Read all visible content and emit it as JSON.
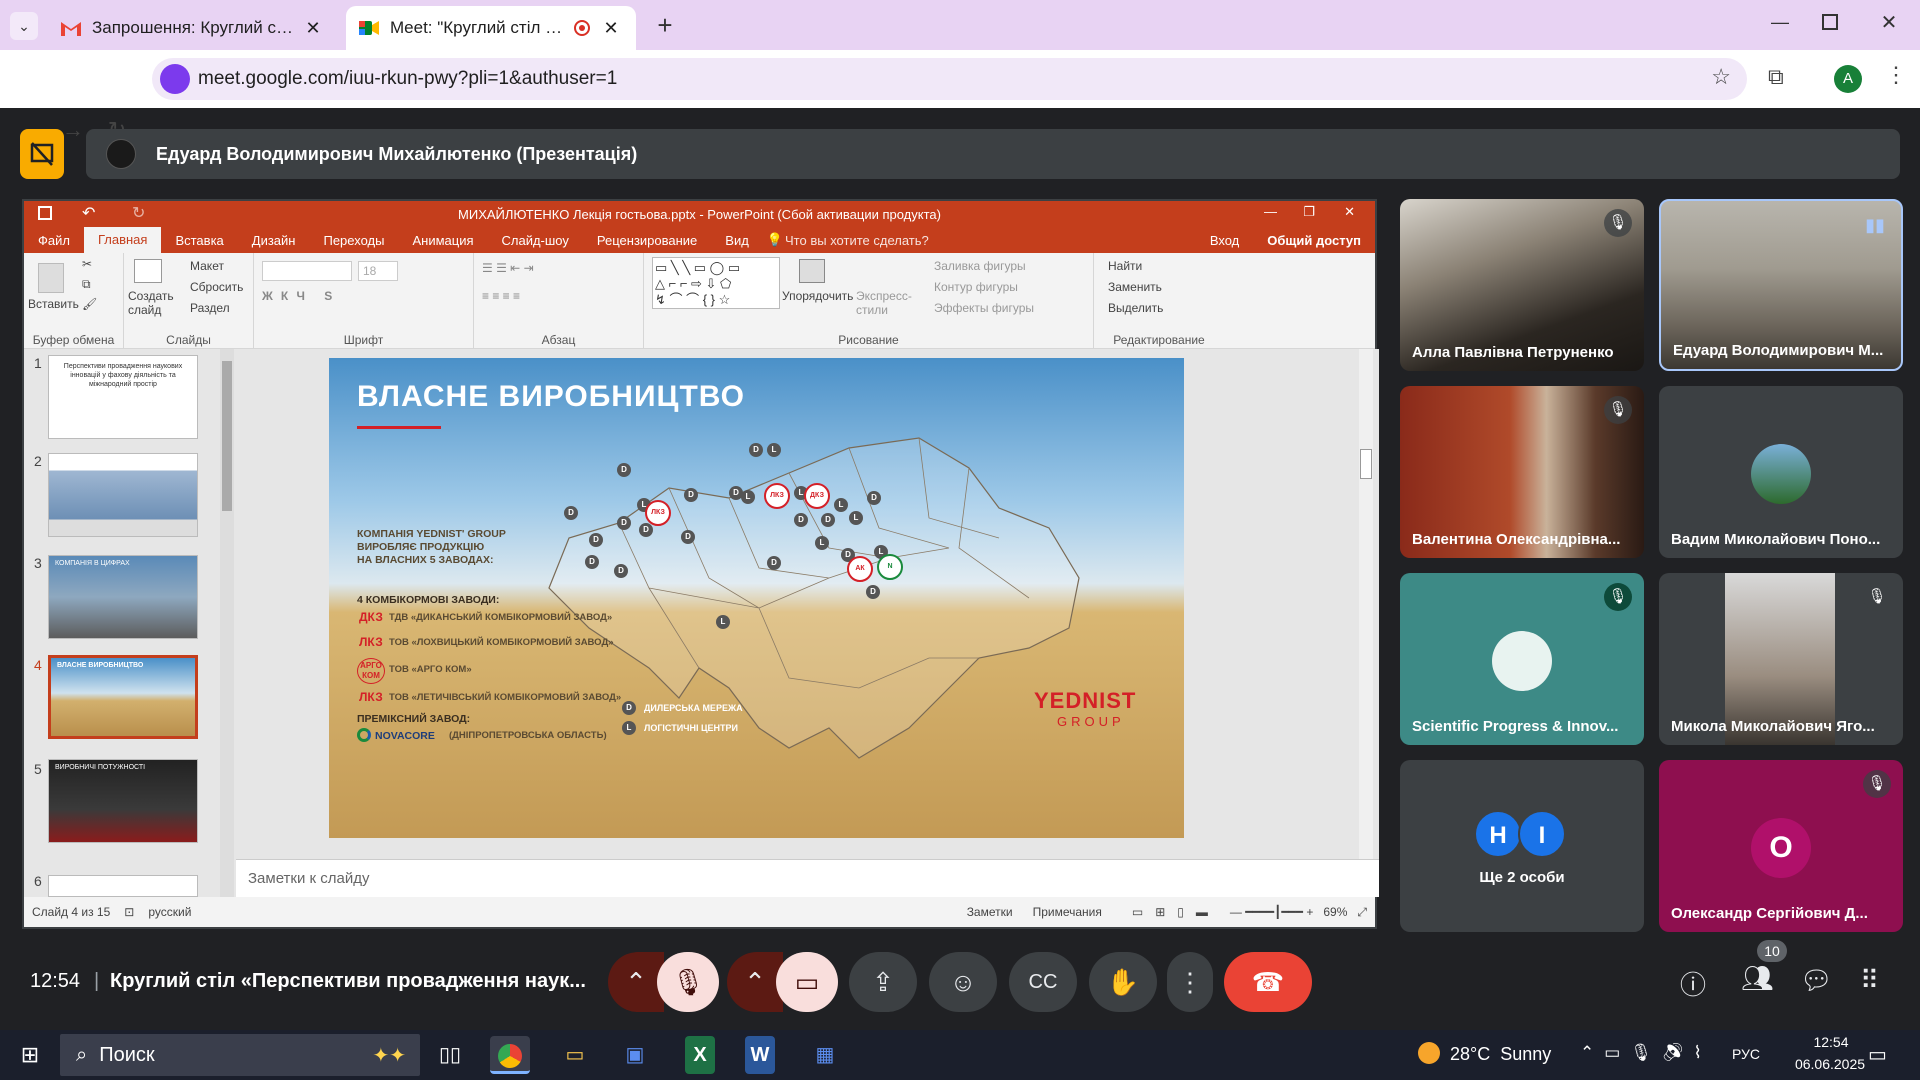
{
  "browser": {
    "tabs": [
      {
        "title": "Запрошення: Круглий стіл «Пе",
        "icon": "gmail-icon"
      },
      {
        "title": "Meet: \"Круглий стіл «Персп",
        "icon": "meet-icon"
      }
    ],
    "new_tab": "+",
    "url": "meet.google.com/iuu-rkun-pwy?pli=1&authuser=1",
    "profile_initial": "A"
  },
  "meet": {
    "presenter_label": "Едуард Володимирович Михайлютенко (Презентація)",
    "time": "12:54",
    "meeting_title": "Круглий стіл «Перспективи провадження наук...",
    "participant_count": "10",
    "participants": [
      {
        "name": "Алла Павлівна Петруненко",
        "muted": true
      },
      {
        "name": "Едуард Володимирович М...",
        "muted": false,
        "speaking": true
      },
      {
        "name": "Валентина Олександрівна...",
        "muted": true
      },
      {
        "name": "Вадим Миколайович Поно...",
        "muted": false
      },
      {
        "name": "Scientific Progress & Innov...",
        "muted": true
      },
      {
        "name": "Микола Миколайович Яго...",
        "muted": true
      },
      {
        "name": "Ще 2 особи",
        "initials": [
          "Н",
          "І"
        ]
      },
      {
        "name": "Олександр Сергійович Д...",
        "initial": "О",
        "muted": true
      }
    ]
  },
  "powerpoint": {
    "title": "МИХАЙЛЮТЕНКО Лекція гостьова.pptx - PowerPoint (Сбой активации продукта)",
    "tabs": [
      "Файл",
      "Главная",
      "Вставка",
      "Дизайн",
      "Переходы",
      "Анимация",
      "Слайд-шоу",
      "Рецензирование",
      "Вид"
    ],
    "tell_me": "Что вы хотите сделать?",
    "login": "Вход",
    "share": "Общий доступ",
    "ribbon": {
      "paste": "Вставить",
      "clipboard": "Буфер обмена",
      "new_slide": "Создать слайд",
      "layout": "Макет",
      "reset": "Сбросить",
      "section": "Раздел",
      "slides": "Слайды",
      "font": "Шрифт",
      "font_size": "18",
      "paragraph": "Абзац",
      "arrange": "Упорядочить",
      "quick_styles": "Экспресс-стили",
      "shape_fill": "Заливка фигуры",
      "shape_outline": "Контур фигуры",
      "shape_effects": "Эффекты фигуры",
      "drawing": "Рисование",
      "find": "Найти",
      "replace": "Заменить",
      "select": "Выделить",
      "editing": "Редактирование"
    },
    "thumb_numbers": [
      "1",
      "2",
      "3",
      "4",
      "5",
      "6"
    ],
    "thumb1_text": "Перспективи провадження наукових інновацій у фахову діяльність та міжнародний простір",
    "thumb3_text": "КОМПАНІЯ В ЦИФРАХ",
    "thumb4_text": "ВЛАСНЕ ВИРОБНИЦТВО",
    "thumb5_text": "ВИРОБНИЧІ ПОТУЖНОСТІ",
    "notes_placeholder": "Заметки к слайду",
    "status_slide": "Слайд 4 из 15",
    "status_lang": "русский",
    "status_notes": "Заметки",
    "status_comments": "Примечания",
    "zoom": "69%"
  },
  "slide": {
    "title": "ВЛАСНЕ ВИРОБНИЦТВО",
    "company_text": [
      "КОМПАНІЯ YEDNIST' GROUP",
      "ВИРОБЛЯЄ ПРОДУКЦІЮ",
      "НА ВЛАСНИХ 5 ЗАВОДАХ:"
    ],
    "feed_plants_label": "4 КОМБІКОРМОВІ ЗАВОДИ:",
    "plants": [
      {
        "logo": "ДКЗ",
        "name": "ТДВ «ДИКАНСЬКИЙ КОМБІКОРМОВИЙ ЗАВОД»"
      },
      {
        "logo": "ЛКЗ",
        "name": "ТОВ «ЛОХВИЦЬКИЙ КОМБІКОРМОВИЙ ЗАВОД»"
      },
      {
        "logo": "АРГО КОМ",
        "name": "ТОВ «АРГО КОМ»"
      },
      {
        "logo": "ЛКЗ",
        "name": "ТОВ «ЛЕТИЧІВСЬКИЙ КОМБІКОРМОВИЙ ЗАВОД»"
      }
    ],
    "premix_label": "ПРЕМІКСНИЙ ЗАВОД:",
    "premix_name": "NOVACORE",
    "premix_region": "(ДНІПРОПЕТРОВСЬКА ОБЛАСТЬ)",
    "legend_d": "ДИЛЕРСЬКА МЕРЕЖА",
    "legend_l": "ЛОГІСТИЧНІ ЦЕНТРИ",
    "brand": "YEDNIST",
    "brand_sub": "GROUP"
  },
  "taskbar": {
    "search": "Поиск",
    "weather": "28°C  Sunny",
    "lang": "РУС",
    "time": "12:54",
    "date": "06.06.2025"
  },
  "colors": {
    "meet_bg": "#202124",
    "tile_bg": "#3c4043",
    "ppt_red": "#c43e1c",
    "end_call": "#ea4335",
    "muted_btn": "#f9dedc",
    "present_yellow": "#f9ab00"
  }
}
